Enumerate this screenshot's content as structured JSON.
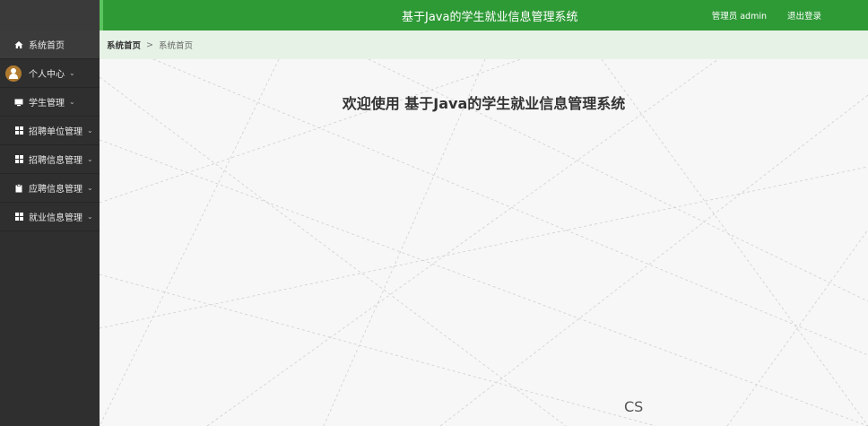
{
  "header": {
    "title": "基于Java的学生就业信息管理系统",
    "user_text": "管理员 admin",
    "logout_label": "退出登录"
  },
  "breadcrumb": {
    "home": "系统首页",
    "separator": ">",
    "current": "系统首页"
  },
  "sidebar": {
    "items": [
      {
        "label": "系统首页",
        "icon": "home-icon"
      },
      {
        "label": "个人中心",
        "icon": "user-icon",
        "expandable": true
      },
      {
        "label": "学生管理",
        "icon": "monitor-icon",
        "expandable": true
      },
      {
        "label": "招聘单位管理",
        "icon": "grid-icon",
        "expandable": true
      },
      {
        "label": "招聘信息管理",
        "icon": "grid-icon",
        "expandable": true
      },
      {
        "label": "应聘信息管理",
        "icon": "clipboard-icon",
        "expandable": true
      },
      {
        "label": "就业信息管理",
        "icon": "grid-icon",
        "expandable": true
      }
    ],
    "chevron": "⌄"
  },
  "main": {
    "welcome": "欢迎使用 基于Java的学生就业信息管理系统",
    "watermark": "CS"
  },
  "colors": {
    "header_bg": "#2e9a36",
    "sidebar_bg": "#2f2f2f",
    "breadcrumb_bg": "#e6f2e6"
  }
}
